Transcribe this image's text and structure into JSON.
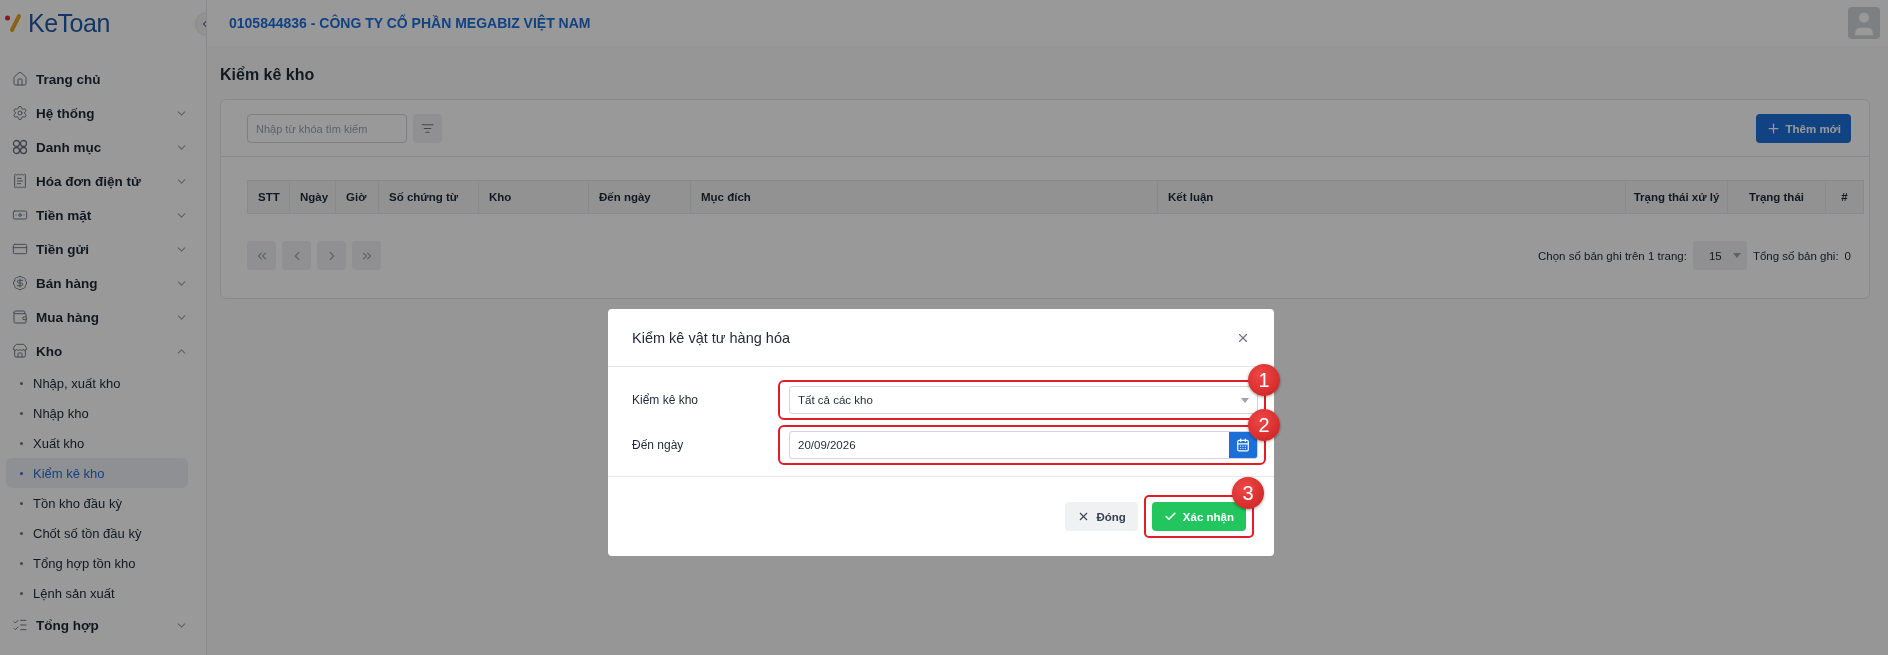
{
  "app": {
    "logo": "KeToan",
    "company": "0105844836 - CÔNG TY CỔ PHẦN MEGABIZ VIỆT NAM"
  },
  "sidebar": {
    "items": [
      {
        "label": "Trang chủ",
        "kind": "link"
      },
      {
        "label": "Hệ thống",
        "kind": "group",
        "expanded": false
      },
      {
        "label": "Danh mục",
        "kind": "group",
        "expanded": false
      },
      {
        "label": "Hóa đơn điện tử",
        "kind": "group",
        "expanded": false
      },
      {
        "label": "Tiền mặt",
        "kind": "group",
        "expanded": false
      },
      {
        "label": "Tiền gửi",
        "kind": "group",
        "expanded": false
      },
      {
        "label": "Bán hàng",
        "kind": "group",
        "expanded": false
      },
      {
        "label": "Mua hàng",
        "kind": "group",
        "expanded": false
      },
      {
        "label": "Kho",
        "kind": "group",
        "expanded": true,
        "children": [
          {
            "label": "Nhập, xuất kho",
            "selected": false
          },
          {
            "label": "Nhập kho",
            "selected": false
          },
          {
            "label": "Xuất kho",
            "selected": false
          },
          {
            "label": "Kiểm kê kho",
            "selected": true
          },
          {
            "label": "Tồn kho đầu kỳ",
            "selected": false
          },
          {
            "label": "Chốt số tồn đầu kỳ",
            "selected": false
          },
          {
            "label": "Tổng hợp tồn kho",
            "selected": false
          },
          {
            "label": "Lệnh sản xuất",
            "selected": false
          }
        ]
      },
      {
        "label": "Tổng hợp",
        "kind": "group",
        "expanded": false
      }
    ]
  },
  "page": {
    "title": "Kiểm kê kho",
    "search": {
      "placeholder": "Nhập từ khóa tìm kiếm"
    },
    "add_button": "Thêm mới",
    "table": {
      "columns": [
        "STT",
        "Ngày",
        "Giờ",
        "Số chứng từ",
        "Kho",
        "Đến ngày",
        "Mục đích",
        "Kết luận",
        "Trạng thái xử lý",
        "Trạng thái",
        "#"
      ]
    },
    "pagination": {
      "page_size_label": "Chọn số bản ghi trên 1 trang:",
      "page_size": "15",
      "total_label": "Tổng số bản ghi:",
      "total": "0"
    }
  },
  "dialog": {
    "title": "Kiểm kê vật tư hàng hóa",
    "fields": [
      {
        "label": "Kiểm kê kho",
        "kind": "select",
        "value": "Tất cả các kho",
        "marker": "1"
      },
      {
        "label": "Đến ngày",
        "kind": "date",
        "value": "20/09/2026",
        "marker": "2"
      }
    ],
    "buttons": [
      {
        "label": "Đóng",
        "kind": "close"
      },
      {
        "label": "Xác nhận",
        "kind": "confirm",
        "marker": "3"
      }
    ]
  }
}
